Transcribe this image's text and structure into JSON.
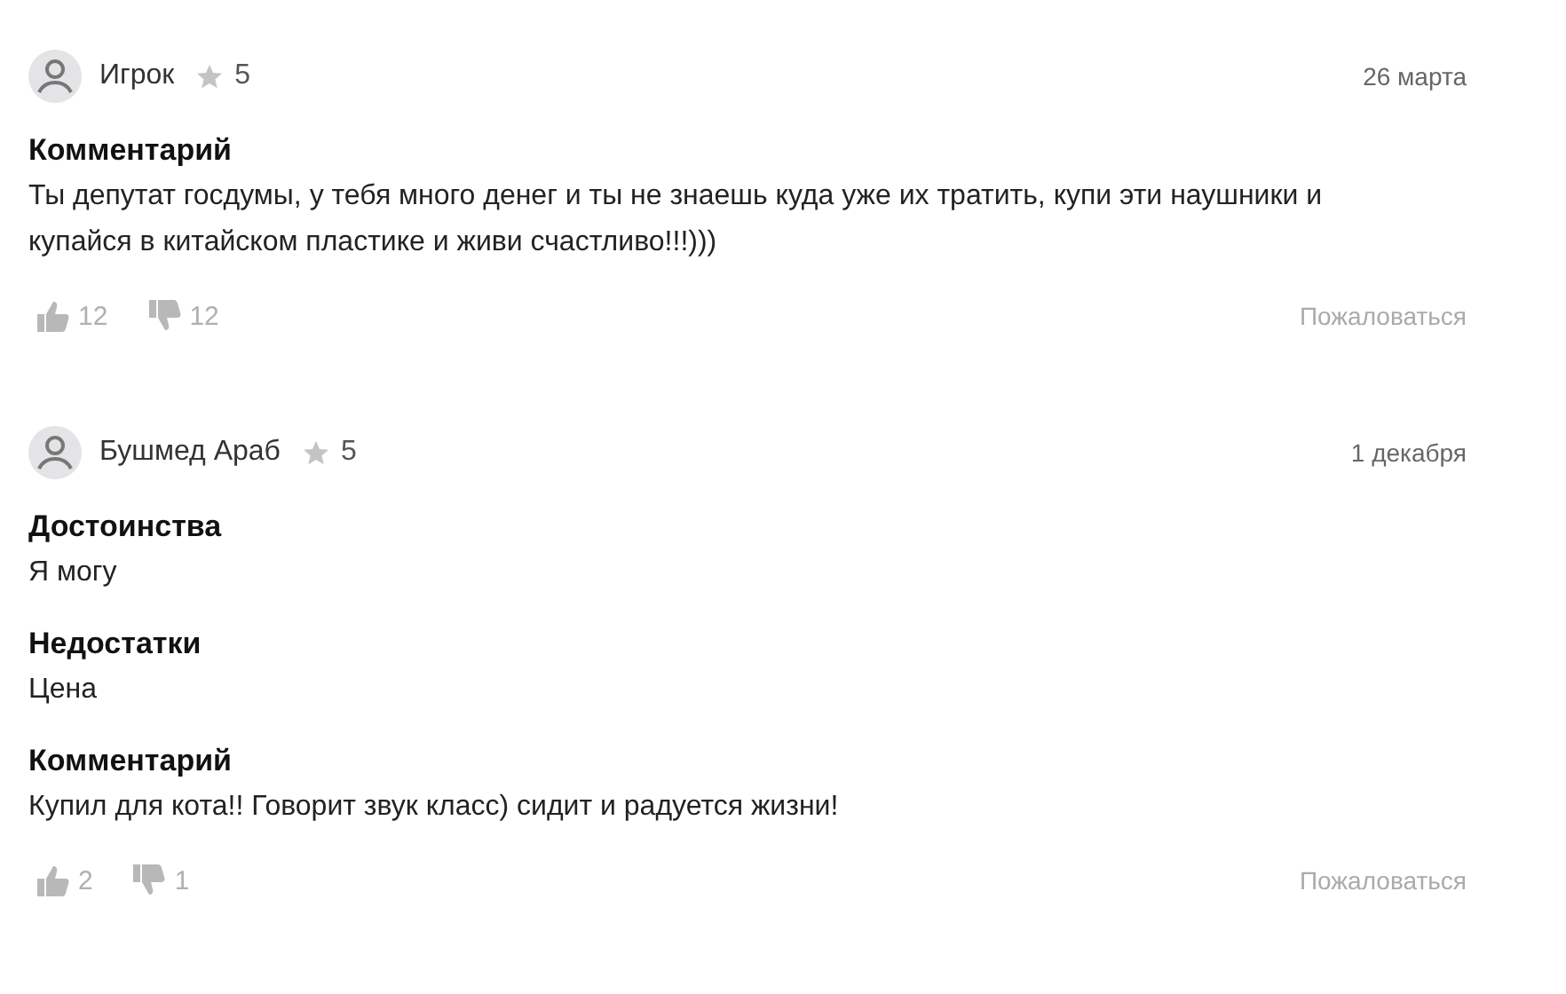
{
  "reviews": [
    {
      "author": "Игрок",
      "rating": "5",
      "date": "26 марта",
      "sections": [
        {
          "title": "Комментарий",
          "text": "Ты депутат госдумы, у тебя много денег и ты не знаешь куда уже их тратить, купи эти наушники и купайся в китайском пластике и живи счастливо!!!)))"
        }
      ],
      "likes": "12",
      "dislikes": "12",
      "report": "Пожаловаться"
    },
    {
      "author": "Бушмед Араб",
      "rating": "5",
      "date": "1 декабря",
      "sections": [
        {
          "title": "Достоинства",
          "text": "Я могу"
        },
        {
          "title": "Недостатки",
          "text": "Цена"
        },
        {
          "title": "Комментарий",
          "text": "Купил для кота!! Говорит звук класс) сидит и радуется жизни!"
        }
      ],
      "likes": "2",
      "dislikes": "1",
      "report": "Пожаловаться"
    }
  ]
}
